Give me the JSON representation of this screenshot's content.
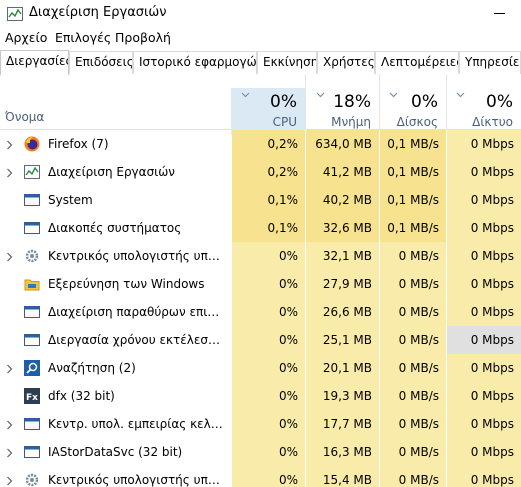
{
  "window": {
    "title": "Διαχείριση Εργασιών"
  },
  "menu": [
    "Αρχείο",
    "Επιλογές",
    "Προβολή"
  ],
  "tabs": [
    "Διεργασίες",
    "Επιδόσεις",
    "Ιστορικό εφαρμογών",
    "Εκκίνηση",
    "Χρήστες",
    "Λεπτομέρειες",
    "Υπηρεσίες"
  ],
  "columns": {
    "name": "Όνομα",
    "cpu": {
      "pct": "0%",
      "label": "CPU"
    },
    "memory": {
      "pct": "18%",
      "label": "Μνήμη"
    },
    "disk": {
      "pct": "0%",
      "label": "Δίσκος"
    },
    "network": {
      "pct": "0%",
      "label": "Δίκτυο"
    }
  },
  "rows": [
    {
      "name": "Firefox (7)",
      "icon": "firefox-icon",
      "expandable": true,
      "cpu": "0,2%",
      "mem": "634,0 MB",
      "disk": "0,1 MB/s",
      "net": "0 Mbps"
    },
    {
      "name": "Διαχείριση Εργασιών",
      "icon": "task-manager-icon",
      "expandable": true,
      "cpu": "0,2%",
      "mem": "41,2 MB",
      "disk": "0,1 MB/s",
      "net": "0 Mbps"
    },
    {
      "name": "System",
      "icon": "system-icon",
      "expandable": false,
      "cpu": "0,1%",
      "mem": "40,2 MB",
      "disk": "0,1 MB/s",
      "net": "0 Mbps"
    },
    {
      "name": "Διακοπές συστήματος",
      "icon": "system-icon",
      "expandable": false,
      "cpu": "0,1%",
      "mem": "32,6 MB",
      "disk": "0,1 MB/s",
      "net": "0 Mbps"
    },
    {
      "name": "Κεντρικός υπολογιστής υπηρε...",
      "icon": "gear-icon",
      "expandable": true,
      "cpu": "0%",
      "mem": "32,1 MB",
      "disk": "0 MB/s",
      "net": "0 Mbps"
    },
    {
      "name": "Εξερεύνηση των Windows",
      "icon": "folder-icon",
      "expandable": false,
      "cpu": "0%",
      "mem": "27,9 MB",
      "disk": "0 MB/s",
      "net": "0 Mbps"
    },
    {
      "name": "Διαχείριση παραθύρων επιφάν...",
      "icon": "window-icon",
      "expandable": false,
      "cpu": "0%",
      "mem": "26,6 MB",
      "disk": "0 MB/s",
      "net": "0 Mbps"
    },
    {
      "name": "Διεργασία χρόνου εκτέλεσης π...",
      "icon": "window-icon",
      "expandable": false,
      "cpu": "0%",
      "mem": "25,1 MB",
      "disk": "0 MB/s",
      "net": "0 Mbps"
    },
    {
      "name": "Αναζήτηση (2)",
      "icon": "search-icon",
      "expandable": true,
      "cpu": "0%",
      "mem": "20,1 MB",
      "disk": "0 MB/s",
      "net": "0 Mbps"
    },
    {
      "name": "dfx (32 bit)",
      "icon": "dfx-icon",
      "expandable": false,
      "cpu": "0%",
      "mem": "19,3 MB",
      "disk": "0 MB/s",
      "net": "0 Mbps"
    },
    {
      "name": "Κεντρ. υπολ. εμπειρίας κελύφο...",
      "icon": "window-icon",
      "expandable": true,
      "cpu": "0%",
      "mem": "17,7 MB",
      "disk": "0 MB/s",
      "net": "0 Mbps"
    },
    {
      "name": "IAStorDataSvc (32 bit)",
      "icon": "window-icon",
      "expandable": true,
      "cpu": "0%",
      "mem": "16,3 MB",
      "disk": "0 MB/s",
      "net": "0 Mbps"
    },
    {
      "name": "Κεντρικός υπολογιστής υπηρε...",
      "icon": "gear-icon",
      "expandable": true,
      "cpu": "0%",
      "mem": "15,4 MB",
      "disk": "0 MB/s",
      "net": "0 Mbps"
    }
  ],
  "colors": {
    "heat_light": "#fff4c4",
    "heat_mid": "#f9ecab",
    "heat_strong": "#f7e38f",
    "sort_column": "#dbe9f5",
    "header_label": "#4c607a"
  }
}
